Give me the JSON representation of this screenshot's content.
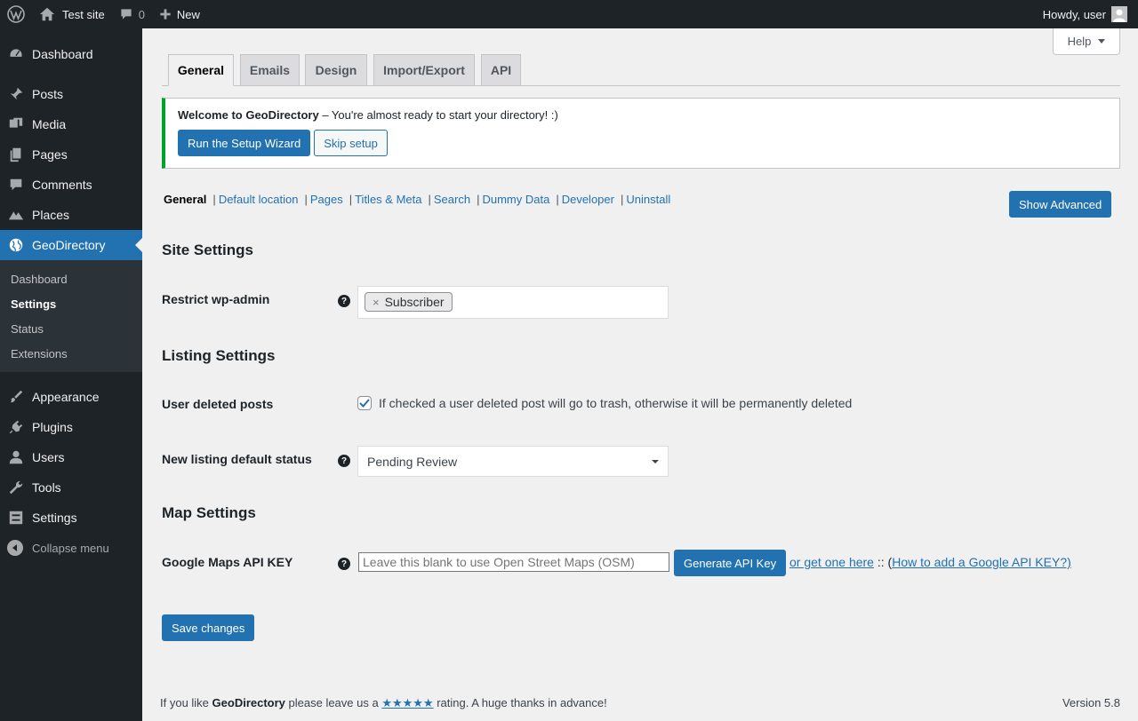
{
  "admin_bar": {
    "site_name": "Test site",
    "comments_count": "0",
    "new_label": "New",
    "howdy": "Howdy, user"
  },
  "sidebar": {
    "items_top": [
      {
        "label": "Dashboard",
        "icon": "dashboard-icon"
      },
      {
        "label": "Posts",
        "icon": "pin-icon"
      },
      {
        "label": "Media",
        "icon": "media-icon"
      },
      {
        "label": "Pages",
        "icon": "pages-icon"
      },
      {
        "label": "Comments",
        "icon": "comment-icon"
      },
      {
        "label": "Places",
        "icon": "places-icon"
      },
      {
        "label": "GeoDirectory",
        "icon": "globe-icon"
      }
    ],
    "submenu": [
      "Dashboard",
      "Settings",
      "Status",
      "Extensions"
    ],
    "items_bottom": [
      {
        "label": "Appearance",
        "icon": "brush-icon"
      },
      {
        "label": "Plugins",
        "icon": "plugin-icon"
      },
      {
        "label": "Users",
        "icon": "user-icon"
      },
      {
        "label": "Tools",
        "icon": "wrench-icon"
      },
      {
        "label": "Settings",
        "icon": "settings-icon"
      }
    ],
    "collapse_label": "Collapse menu"
  },
  "help_label": "Help",
  "tabs": [
    "General",
    "Emails",
    "Design",
    "Import/Export",
    "API"
  ],
  "notice": {
    "title": "Welcome to GeoDirectory",
    "text": " – You're almost ready to start your directory! :)",
    "wizard_btn": "Run the Setup Wizard",
    "skip_btn": "Skip setup"
  },
  "subsubsub": {
    "current": "General",
    "links": [
      "Default location",
      "Pages",
      "Titles & Meta",
      "Search",
      "Dummy Data",
      "Developer",
      "Uninstall"
    ]
  },
  "show_advanced": "Show Advanced",
  "sections": {
    "site": "Site Settings",
    "listing": "Listing Settings",
    "map": "Map Settings"
  },
  "fields": {
    "restrict_label": "Restrict wp-admin",
    "restrict_chip": "Subscriber",
    "deleted_label": "User deleted posts",
    "deleted_desc": "If checked a user deleted post will go to trash, otherwise it will be permanently deleted",
    "status_label": "New listing default status",
    "status_value": "Pending Review",
    "api_label": "Google Maps API KEY",
    "api_placeholder": "Leave this blank to use Open Street Maps (OSM)",
    "generate_btn": "Generate API Key",
    "get_one_link": "or get one here",
    "sep_text": " :: (",
    "how_link": "How to add a Google API KEY?)"
  },
  "save_btn": "Save changes",
  "footer": {
    "prefix": "If you like ",
    "brand": "GeoDirectory",
    "middle": " please leave us a ",
    "stars": "★★★★★",
    "suffix": " rating. A huge thanks in advance!",
    "version": "Version 5.8"
  }
}
